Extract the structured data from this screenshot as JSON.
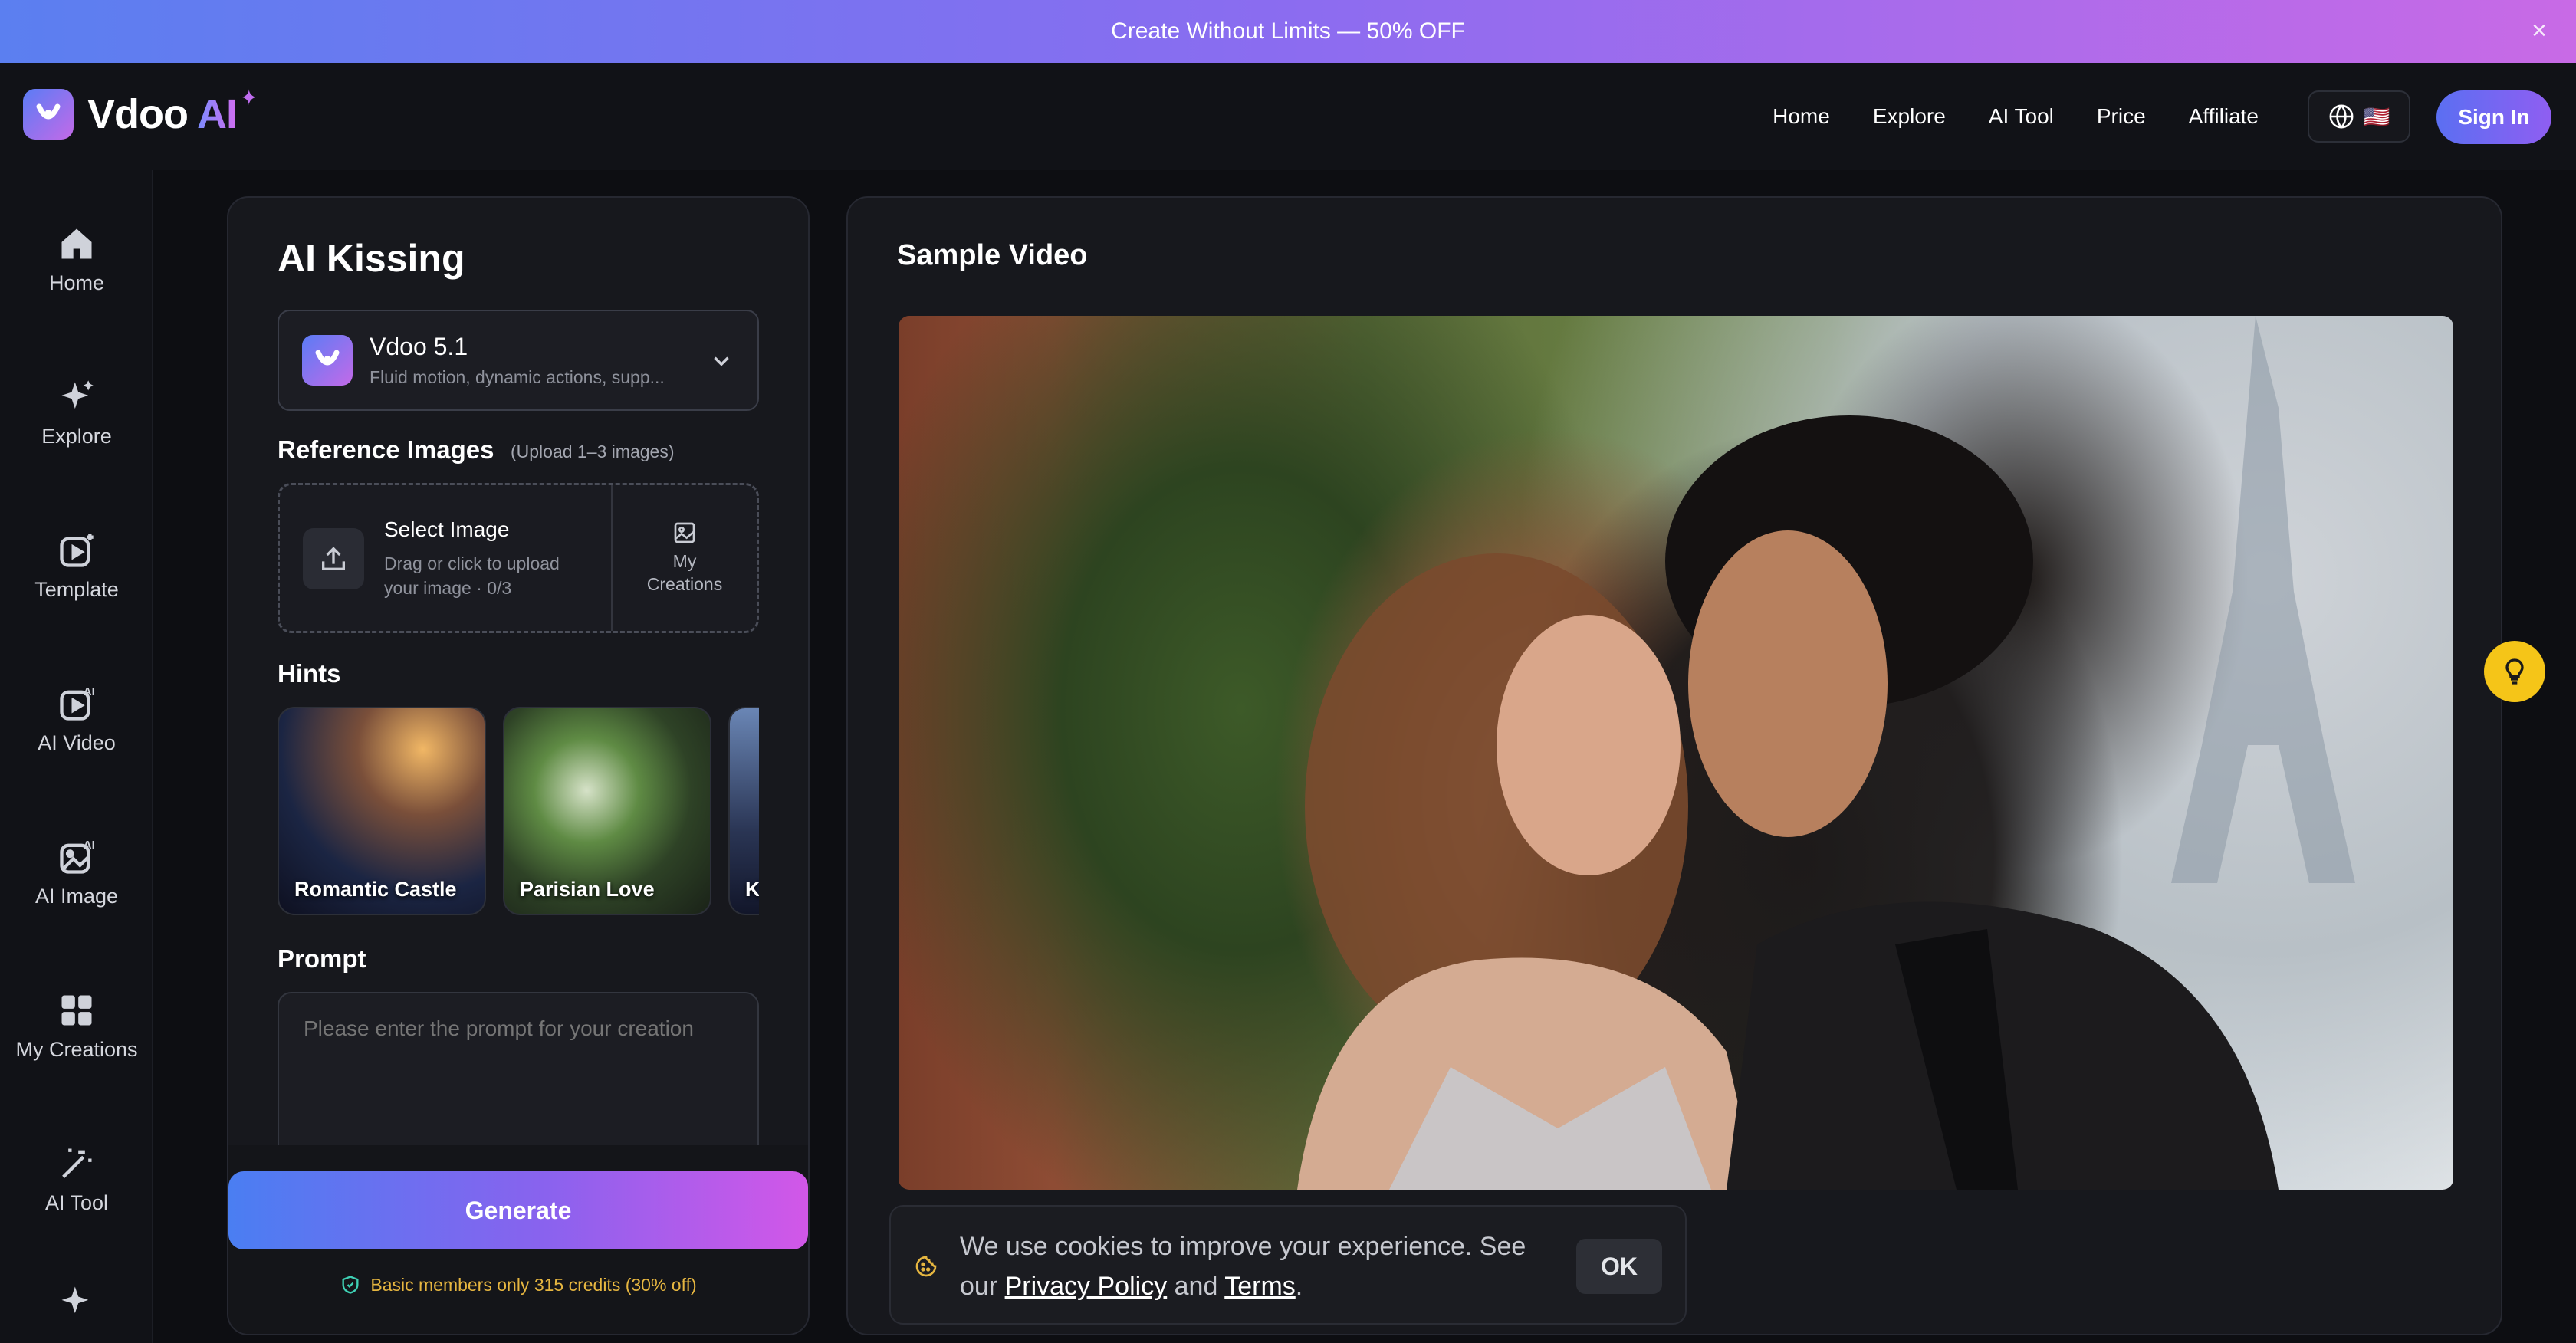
{
  "promo": {
    "text": "Create Without Limits — 50% OFF",
    "close_icon": "close-icon"
  },
  "brand": {
    "name": "Vdoo",
    "ai": "AI",
    "logo_icon": "vdoo-logo-icon",
    "spark": "✦"
  },
  "nav": {
    "links": [
      "Home",
      "Explore",
      "AI Tool",
      "Price",
      "Affiliate"
    ],
    "lang_flag": "🇺🇸",
    "sign_in": "Sign In"
  },
  "sidebar": {
    "items": [
      {
        "label": "Home",
        "icon": "home-icon"
      },
      {
        "label": "Explore",
        "icon": "sparkle-icon"
      },
      {
        "label": "Template",
        "icon": "template-icon"
      },
      {
        "label": "AI Video",
        "icon": "ai-video-icon"
      },
      {
        "label": "AI Image",
        "icon": "ai-image-icon"
      },
      {
        "label": "My Creations",
        "icon": "grid-icon"
      },
      {
        "label": "AI Tool",
        "icon": "magic-wand-icon"
      }
    ]
  },
  "tool": {
    "title": "AI Kissing",
    "model": {
      "name": "Vdoo 5.1",
      "desc": "Fluid motion, dynamic actions, supp..."
    },
    "reference": {
      "label": "Reference Images",
      "hint": "(Upload 1–3 images)",
      "select_title": "Select Image",
      "select_sub": "Drag or click to upload your image · 0/3",
      "my_creations": "My Creations"
    },
    "hints_label": "Hints",
    "hints": [
      "Romantic Castle",
      "Parisian Love",
      "Ki"
    ],
    "prompt_label": "Prompt",
    "prompt_placeholder": "Please enter the prompt for your creation",
    "generate": "Generate",
    "credits_note": "Basic members only 315 credits (30% off)"
  },
  "sample": {
    "title": "Sample Video"
  },
  "cookie": {
    "text_before": "We use cookies to improve your experience. See our ",
    "privacy": "Privacy Policy",
    "and": " and ",
    "terms": "Terms",
    "period": ".",
    "ok": "OK"
  },
  "colors": {
    "accent_start": "#4a7ef2",
    "accent_end": "#d257e8",
    "credits": "#e6b640",
    "tip": "#f5c518"
  }
}
